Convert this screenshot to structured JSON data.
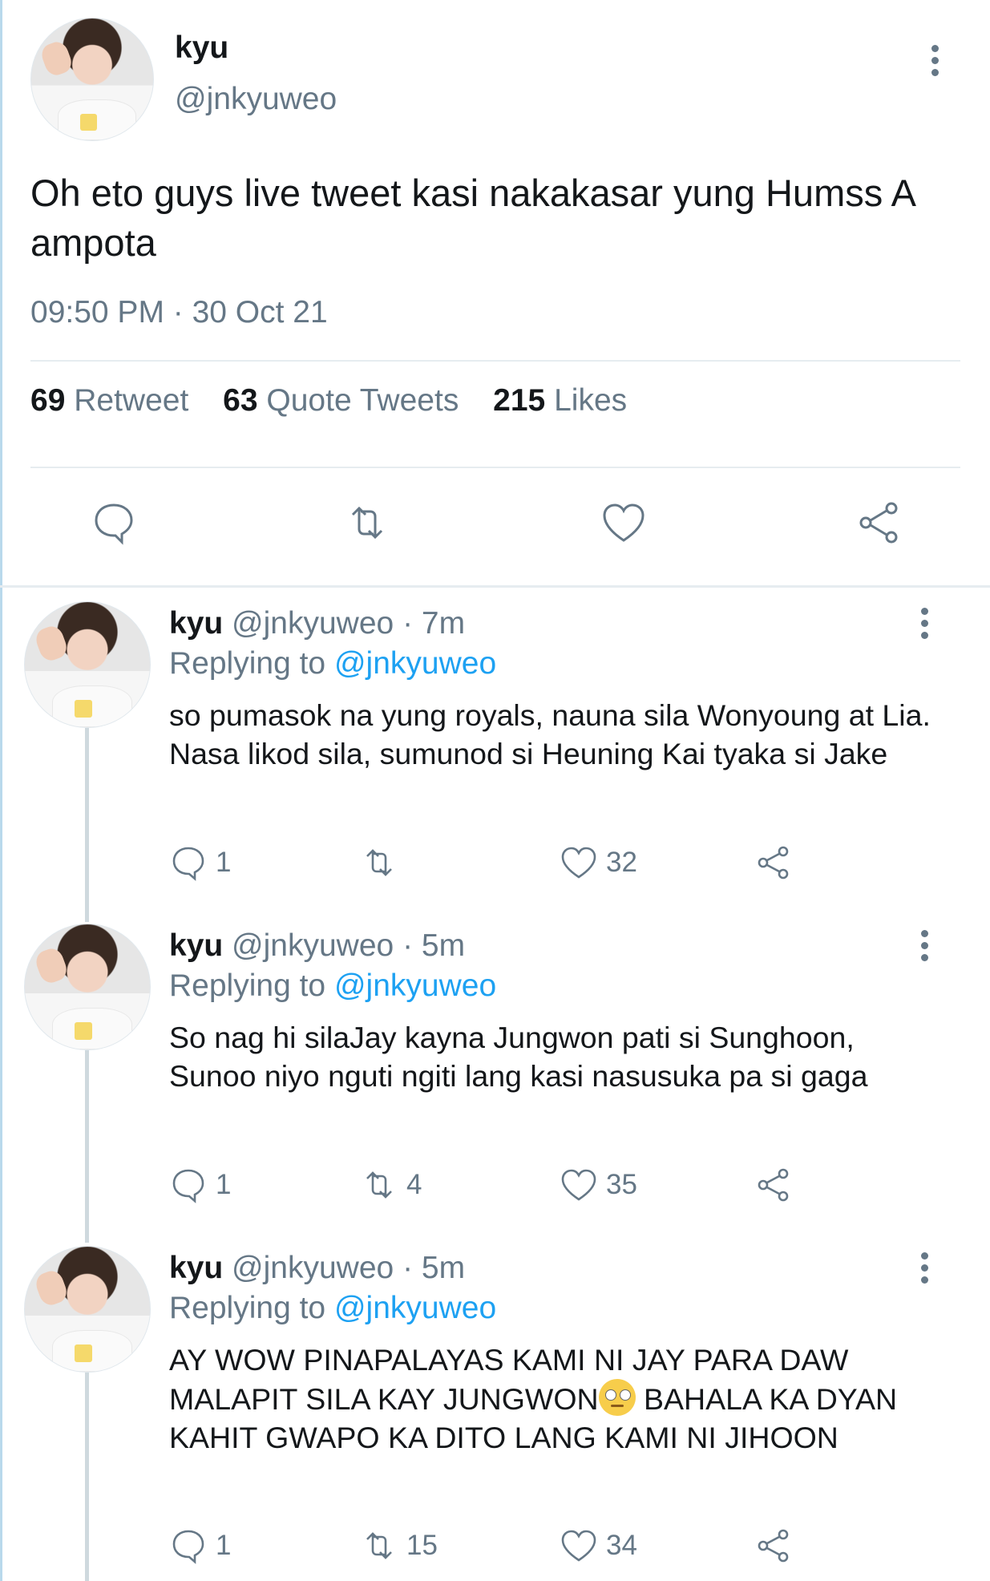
{
  "main_tweet": {
    "author_name": "kyu",
    "author_handle": "@jnkyuweo",
    "text": "Oh eto guys live tweet kasi nakakasar yung Humss A ampota",
    "timestamp": "09:50 PM · 30 Oct 21",
    "stats": {
      "retweets_count": "69",
      "retweets_label": "Retweet",
      "quotes_count": "63",
      "quotes_label": "Quote Tweets",
      "likes_count": "215",
      "likes_label": "Likes"
    },
    "actions": [
      "reply-icon",
      "retweet-icon",
      "like-icon",
      "share-icon"
    ]
  },
  "replies": [
    {
      "name": "kyu",
      "handle": "@jnkyuweo",
      "dot": "·",
      "time": "7m",
      "replying_label": "Replying to",
      "replying_to": "@jnkyuweo",
      "text": "so pumasok na yung royals, nauna sila Wonyoung at Lia. Nasa likod sila, sumunod si Heuning Kai tyaka si Jake",
      "replies": "1",
      "retweets": "",
      "likes": "32"
    },
    {
      "name": "kyu",
      "handle": "@jnkyuweo",
      "dot": "·",
      "time": "5m",
      "replying_label": "Replying to",
      "replying_to": "@jnkyuweo",
      "text": "So nag hi silaJay kayna Jungwon pati si Sunghoon, Sunoo niyo nguti ngiti lang kasi nasusuka pa si gaga",
      "replies": "1",
      "retweets": "4",
      "likes": "35"
    },
    {
      "name": "kyu",
      "handle": "@jnkyuweo",
      "dot": "·",
      "time": "5m",
      "replying_label": "Replying to",
      "replying_to": "@jnkyuweo",
      "text_before_emoji": "AY WOW PINAPALAYAS KAMI NI JAY PARA DAW MALAPIT SILA KAY JUNGWON",
      "emoji": "face-with-rolling-eyes",
      "text_after_emoji": " BAHALA KA DYAN KAHIT GWAPO KA DITO LANG KAMI NI JIHOON",
      "replies": "1",
      "retweets": "15",
      "likes": "34"
    }
  ],
  "colors": {
    "accent": "#1da1f2",
    "muted": "#657786",
    "text": "#14171a",
    "divider": "#e6ecf0"
  }
}
